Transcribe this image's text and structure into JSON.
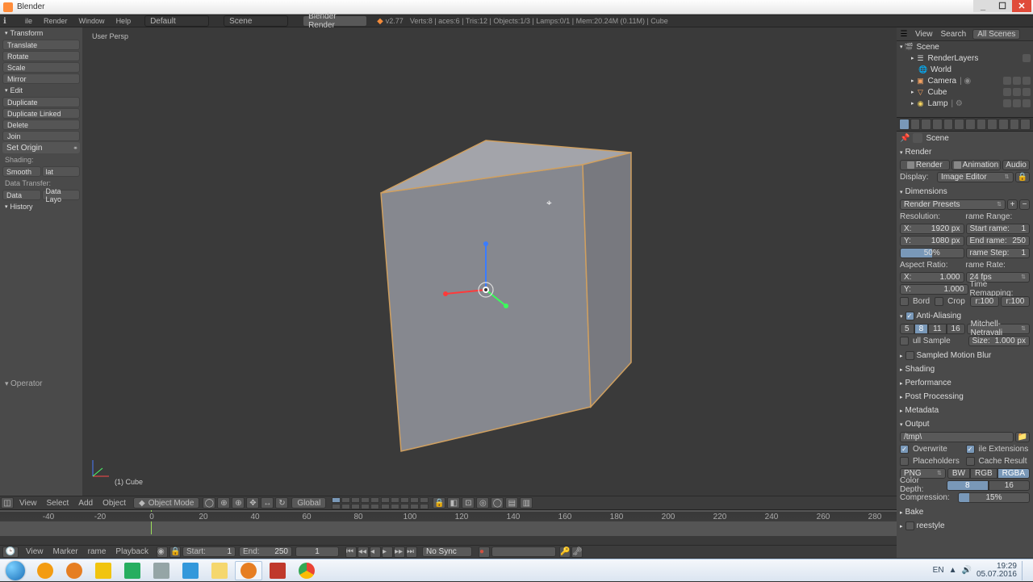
{
  "titlebar": {
    "title": "Blender"
  },
  "menubar": {
    "items": [
      "ile",
      "Render",
      "Window",
      "Help"
    ],
    "layout": "Default",
    "scene": "Scene",
    "engine": "Blender Render",
    "version": "v2.77",
    "stats": "Verts:8 | aces:6 | Tris:12 | Objects:1/3 | Lamps:0/1 | Mem:20.24M (0.11M) | Cube"
  },
  "toolbox": {
    "transform": {
      "title": "Transform",
      "translate": "Translate",
      "rotate": "Rotate",
      "scale": "Scale",
      "mirror": "Mirror"
    },
    "edit": {
      "title": "Edit",
      "duplicate": "Duplicate",
      "duplicate_linked": "Duplicate Linked",
      "delete": "Delete",
      "join": "Join",
      "set_origin": "Set Origin"
    },
    "shading": {
      "label": "Shading:",
      "smooth": "Smooth",
      "flat": "lat"
    },
    "data_transfer": {
      "label": "Data Transfer:",
      "data": "Data",
      "data_layo": "Data Layo"
    },
    "history": {
      "title": "History"
    },
    "operator": {
      "title": "Operator"
    }
  },
  "viewport": {
    "persp": "User Persp",
    "object": "(1) Cube"
  },
  "viewheader": {
    "menus": [
      "View",
      "Select",
      "Add",
      "Object"
    ],
    "mode": "Object Mode",
    "orientation": "Global"
  },
  "timeline": {
    "ticks": [
      "-40",
      "-20",
      "0",
      "20",
      "40",
      "60",
      "80",
      "100",
      "120",
      "140",
      "160",
      "180",
      "200",
      "220",
      "240",
      "260",
      "280"
    ],
    "menus": [
      "View",
      "Marker",
      "rame",
      "Playback"
    ],
    "start": {
      "label": "Start:",
      "value": "1"
    },
    "end": {
      "label": "End:",
      "value": "250"
    },
    "current": "1",
    "sync": "No Sync"
  },
  "outliner": {
    "menus": [
      "View",
      "Search"
    ],
    "filter": "All Scenes",
    "scene": "Scene",
    "renderlayers": "RenderLayers",
    "world": "World",
    "camera": "Camera",
    "cube": "Cube",
    "lamp": "Lamp"
  },
  "props": {
    "crumb_scene": "Scene",
    "render": {
      "title": "Render",
      "render_btn": "Render",
      "anim_btn": "Animation",
      "audio_btn": "Audio",
      "display": "Display:",
      "display_val": "Image Editor"
    },
    "dimensions": {
      "title": "Dimensions",
      "presets": "Render Presets",
      "resolution": "Resolution:",
      "frange": "rame Range:",
      "x": "X:",
      "xval": "1920 px",
      "y": "Y:",
      "yval": "1080 px",
      "pct": "50%",
      "start": "Start rame:",
      "startv": "1",
      "end": "End rame:",
      "endv": "250",
      "step": "rame Step:",
      "stepv": "1",
      "aspect": "Aspect Ratio:",
      "frate": "rame Rate:",
      "ax": "X:",
      "axval": "1.000",
      "ay": "Y:",
      "ayval": "1.000",
      "fps": "24 fps",
      "tremap": "Time Remapping:",
      "border": "Bord",
      "crop": "Crop",
      "r100a": "r:100",
      "r100b": "r:100"
    },
    "aa": {
      "title": "Anti-Aliasing",
      "samples": [
        "5",
        "8",
        "11",
        "16"
      ],
      "filter": "Mitchell-Netravali",
      "label": "ull Sample",
      "sizelbl": "Size:",
      "size": "1.000 px"
    },
    "smb": "Sampled Motion Blur",
    "shading": "Shading",
    "performance": "Performance",
    "postproc": "Post Processing",
    "metadata": "Metadata",
    "output": {
      "title": "Output",
      "path": "/tmp\\",
      "overwrite": "Overwrite",
      "placeholders": "Placeholders",
      "ext": "ile Extensions",
      "cache": "Cache Result",
      "format": "PNG",
      "cs": [
        "BW",
        "RGB",
        "RGBA"
      ],
      "depth": "Color Depth:",
      "d8": "8",
      "d16": "16",
      "comp": "Compression:",
      "compval": "15%"
    },
    "bake": "Bake",
    "freestyle": "reestyle"
  },
  "taskbar": {
    "time": "19:29",
    "date": "05.07.2016",
    "lang": "EN"
  }
}
